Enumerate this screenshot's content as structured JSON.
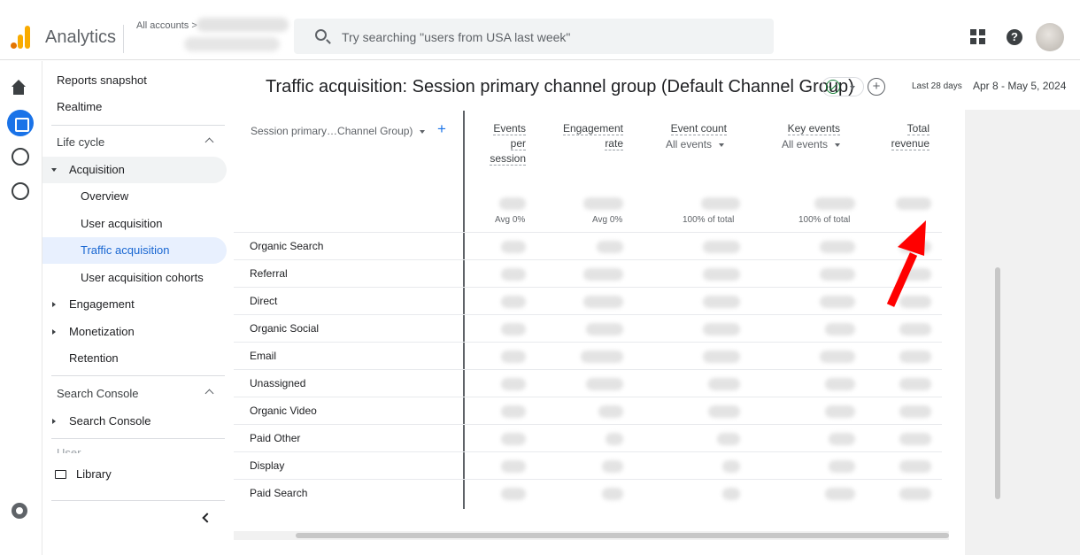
{
  "header": {
    "app_name": "Analytics",
    "all_accounts": "All accounts >",
    "search_placeholder": "Try searching \"users from USA last week\""
  },
  "sidebar": {
    "reports_snapshot": "Reports snapshot",
    "realtime": "Realtime",
    "lifecycle_title": "Life cycle",
    "acquisition": "Acquisition",
    "overview": "Overview",
    "user_acquisition": "User acquisition",
    "traffic_acquisition": "Traffic acquisition",
    "user_acquisition_cohorts": "User acquisition cohorts",
    "engagement": "Engagement",
    "monetization": "Monetization",
    "retention": "Retention",
    "search_console_title": "Search Console",
    "search_console": "Search Console",
    "user_title": "User",
    "library": "Library"
  },
  "report": {
    "title": "Traffic acquisition: Session primary channel group (Default Channel Group)",
    "date_prefix": "Last 28 days",
    "date_range": "Apr 8 - May 5, 2024"
  },
  "table": {
    "dimension_header": "Session primary…Channel Group)",
    "columns": {
      "events_per_session": [
        "Events",
        "per",
        "session"
      ],
      "engagement_rate": [
        "Engagement",
        "rate"
      ],
      "event_count": [
        "Event count"
      ],
      "key_events": [
        "Key events"
      ],
      "total_revenue": [
        "Total",
        "revenue"
      ]
    },
    "event_count_filter": "All events",
    "key_events_filter": "All events",
    "totals": {
      "events_per_session": "Avg 0%",
      "engagement_rate": "Avg 0%",
      "event_count": "100% of total",
      "key_events": "100% of total"
    },
    "rows": [
      "Organic Search",
      "Referral",
      "Direct",
      "Organic Social",
      "Email",
      "Unassigned",
      "Organic Video",
      "Paid Other",
      "Display",
      "Paid Search"
    ]
  },
  "colors": {
    "accent": "#1a73e8",
    "active_nav_bg": "#e8f0fe",
    "annotation_arrow": "#ff0000"
  },
  "icons": [
    "search-icon",
    "apps-icon",
    "help-icon",
    "home-icon",
    "reports-icon",
    "explore-icon",
    "advertising-icon",
    "settings-icon",
    "folder-icon",
    "check-circle-icon"
  ]
}
